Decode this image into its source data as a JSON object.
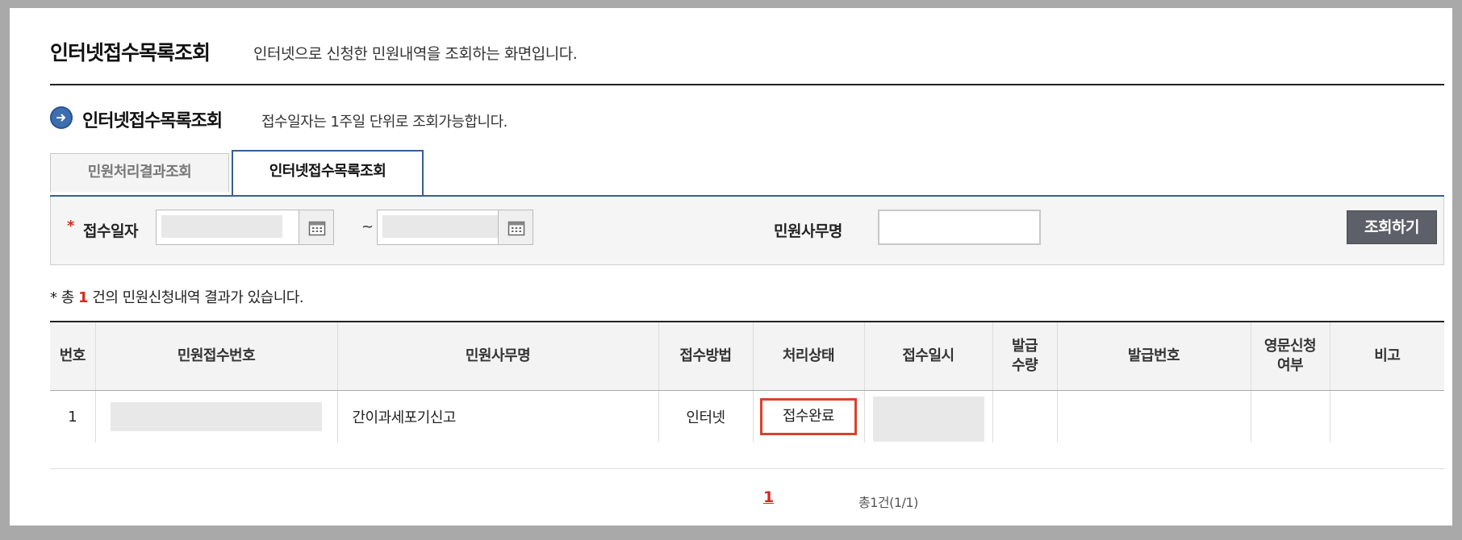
{
  "header": {
    "title": "인터넷접수목록조회",
    "subtitle": "인터넷으로 신청한 민원내역을 조회하는 화면입니다."
  },
  "section": {
    "title": "인터넷접수목록조회",
    "description": "접수일자는 1주일 단위로 조회가능합니다.",
    "icon": "arrow-right-circle-icon"
  },
  "tabs": [
    {
      "label": "민원처리결과조회",
      "active": false
    },
    {
      "label": "인터넷접수목록조회",
      "active": true
    }
  ],
  "search": {
    "required_mark": "*",
    "date_label": "접수일자",
    "date_from_value": "",
    "date_to_value": "",
    "range_separator": "~",
    "office_label": "민원사무명",
    "office_value": "",
    "button_label": "조회하기"
  },
  "summary": {
    "prefix": "* 총 ",
    "count": "1",
    "suffix": " 건의 민원신청내역 결과가 있습니다."
  },
  "table": {
    "headers": {
      "no": "번호",
      "receipt_no": "민원접수번호",
      "office_name": "민원사무명",
      "method": "접수방법",
      "status": "처리상태",
      "received_at": "접수일시",
      "issue_qty_1": "발급",
      "issue_qty_2": "수량",
      "issue_no": "발급번호",
      "english_1": "영문신청",
      "english_2": "여부",
      "remark": "비고"
    },
    "rows": [
      {
        "no": "1",
        "receipt_no": "",
        "office_name": "간이과세포기신고",
        "method": "인터넷",
        "status": "접수완료",
        "received_at": "",
        "issue_qty": "",
        "issue_no": "",
        "english": "",
        "remark": ""
      }
    ]
  },
  "pagination": {
    "current": "1",
    "total_text": "총1건(1/1)"
  },
  "colors": {
    "accent_blue": "#35608f",
    "highlight_red": "#d32a1e",
    "button_gray": "#5d6068"
  }
}
